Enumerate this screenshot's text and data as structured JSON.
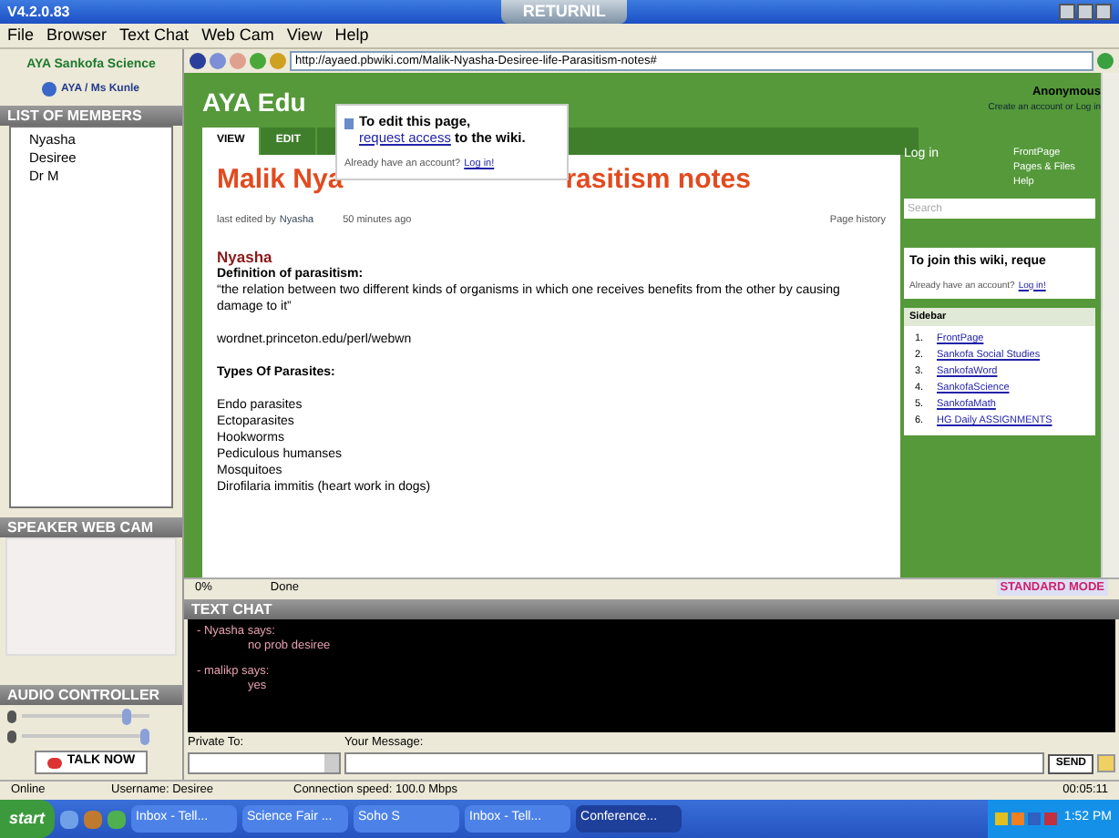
{
  "window": {
    "title": "V4.2.0.83",
    "overlay_tab": "RETURNIL"
  },
  "menu": [
    "File",
    "Browser",
    "Text Chat",
    "Web Cam",
    "View",
    "Help"
  ],
  "left": {
    "group": "AYA Sankofa Science",
    "teacher_button": "AYA / Ms Kunle",
    "members_header": "LIST OF MEMBERS",
    "members": [
      "Nyasha",
      "Desiree",
      "Dr M"
    ],
    "webcam_header": "SPEAKER WEB CAM",
    "audio_header": "AUDIO CONTROLLER",
    "sliders": [
      {
        "level": 0.85
      },
      {
        "level": 1
      }
    ],
    "talk_button": "TALK NOW"
  },
  "browser": {
    "address": "http://ayaed.pbwiki.com/Malik-Nyasha-Desiree-life-Parasitism-notes#",
    "progress": "0%",
    "status": "Done",
    "mode": "STANDARD MODE"
  },
  "wiki": {
    "site_title": "AYA Edu",
    "user": "Anonymous",
    "account_text": "Create an account or Log in",
    "tabs": [
      {
        "label": "VIEW",
        "selected": true
      },
      {
        "label": "EDIT",
        "selected": false
      }
    ],
    "title_start": "Malik Nya",
    "title_end": "rasitism notes",
    "edited_prefix": "last edited by",
    "editor": "Nyasha",
    "edited_time": "50 minutes ago",
    "history": "Page history",
    "author": "Nyasha",
    "definition_heading": "Definition of parasitism:",
    "definition": "“the relation between two different kinds of organisms in which one receives benefits from the other by causing damage to it”",
    "source": "wordnet.princeton.edu/perl/webwn",
    "types_heading": "Types Of Parasites:",
    "types": [
      "Endo parasites",
      "Ectoparasites",
      "Hookworms",
      "Pediculous humanses",
      "Mosquitoes",
      "Dirofilaria immitis (heart work in dogs)"
    ],
    "login": "Log in",
    "nav_links": [
      "FrontPage",
      "Pages & Files",
      "Help"
    ],
    "search": {
      "placeholder": "Search"
    },
    "join_text": "To join this wiki, reque",
    "join_account": "Already have an account?",
    "join_login": "Log in!",
    "sidebar_header": "Sidebar",
    "sidebar_links": [
      {
        "number": "1.",
        "label": "FrontPage"
      },
      {
        "number": "2.",
        "label": "Sankofa Social Studies"
      },
      {
        "number": "3.",
        "label": "SankofaWord"
      },
      {
        "number": "4.",
        "label": "SankofaScience"
      },
      {
        "number": "5.",
        "label": "SankofaMath"
      },
      {
        "number": "6.",
        "label": "HG Daily ASSIGNMENTS"
      }
    ],
    "popup": {
      "line1": "To edit this page,",
      "link": "request access",
      "line2": "to the wiki.",
      "account": "Already have an account?",
      "login": "Log in!"
    }
  },
  "chat": {
    "header": "TEXT CHAT",
    "messages": [
      {
        "sender": "- Nyasha says:",
        "text": "no prob desiree"
      },
      {
        "sender": "- malikp says:",
        "text": "yes"
      }
    ],
    "private_label": "Private To:",
    "message_label": "Your Message:",
    "send": "SEND"
  },
  "status_bar": {
    "state": "Online",
    "username": "Username: Desiree",
    "speed": "Connection speed: 100.0 Mbps",
    "time": "00:05:11"
  },
  "taskbar": {
    "start": "start",
    "tasks": [
      {
        "label": "Inbox - Tell...",
        "selected": false
      },
      {
        "label": "Science Fair ...",
        "selected": false
      },
      {
        "label": "Soho S",
        "selected": false
      },
      {
        "label": "Inbox - Tell...",
        "selected": false
      },
      {
        "label": "Conference...",
        "selected": true
      }
    ],
    "clock": "1:52 PM"
  }
}
